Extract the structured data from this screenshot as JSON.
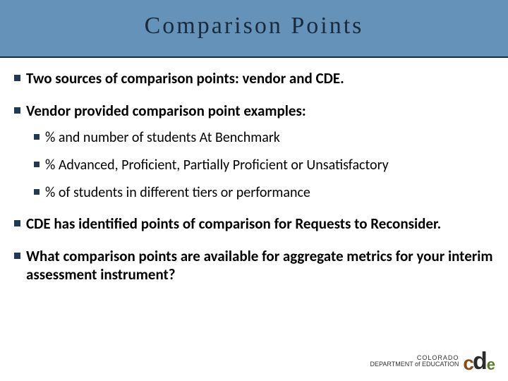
{
  "title": "Comparison Points",
  "bullets": [
    {
      "text": "Two sources of comparison points: vendor and CDE.",
      "bold": true
    },
    {
      "text": "Vendor provided comparison point examples:",
      "bold": true,
      "sub": [
        "% and number of students At Benchmark",
        "% Advanced, Proficient, Partially Proficient or Unsatisfactory",
        "% of students in different tiers or performance"
      ]
    },
    {
      "text": "CDE has identified points of comparison for Requests to Reconsider.",
      "bold": true
    },
    {
      "text": "What comparison points are available for aggregate metrics for your interim assessment instrument?",
      "bold": true
    }
  ],
  "footer": {
    "state": "COLORADO",
    "dept": "DEPARTMENT of EDUCATION",
    "logo_c": "c",
    "logo_d": "d",
    "logo_e": "e"
  }
}
